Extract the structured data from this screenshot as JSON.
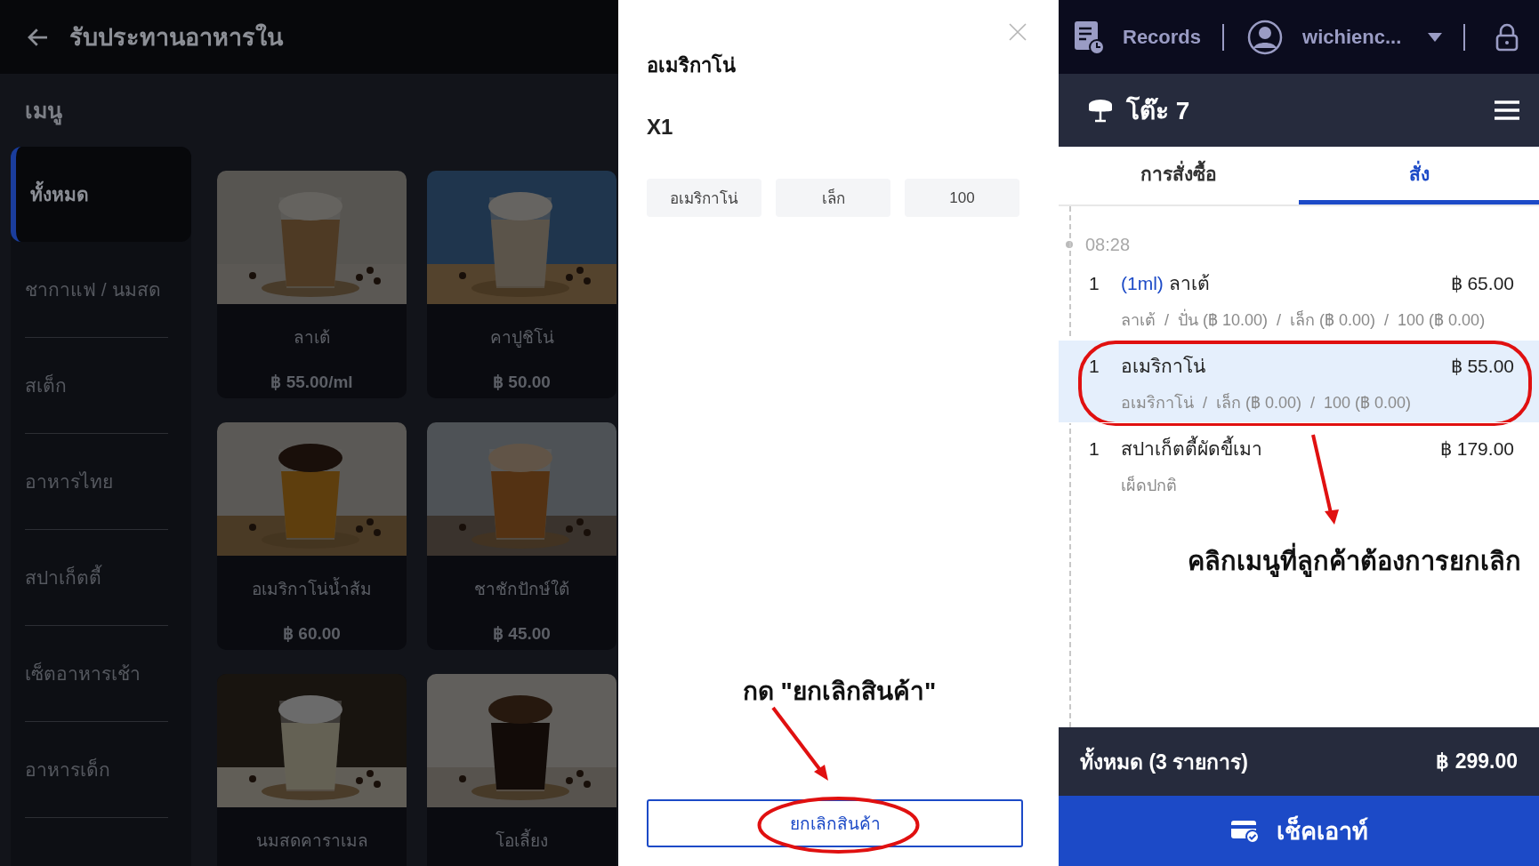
{
  "header": {
    "title": "รับประทานอาหารใน"
  },
  "menu": {
    "heading": "เมนู",
    "categories": [
      {
        "label": "ทั้งหมด",
        "selected": true
      },
      {
        "label": "ชากาแฟ / นมสด",
        "selected": false
      },
      {
        "label": "สเต็ก",
        "selected": false
      },
      {
        "label": "อาหารไทย",
        "selected": false
      },
      {
        "label": "สปาเก็ตตี้",
        "selected": false
      },
      {
        "label": "เซ็ตอาหารเช้า",
        "selected": false
      },
      {
        "label": "อาหารเด็ก",
        "selected": false
      }
    ],
    "products": [
      {
        "name": "ลาเต้",
        "price": "฿ 55.00/ml"
      },
      {
        "name": "คาปูชิโน่",
        "price": "฿ 50.00"
      },
      {
        "name": "อเมริกาโน่น้ำส้ม",
        "price": "฿ 60.00"
      },
      {
        "name": "ชาชักปักษ์ใต้",
        "price": "฿ 45.00"
      },
      {
        "name": "นมสดคาราเมล"
      },
      {
        "name": "โอเลี้ยง"
      }
    ]
  },
  "dialog": {
    "title": "อเมริกาโน่",
    "quantity": "X1",
    "options": [
      "อเมริกาโน่",
      "เล็ก",
      "100"
    ],
    "annotation": "กด \"ยกเลิกสินค้า\"",
    "cancel_button": "ยกเลิกสินค้า"
  },
  "top_bar": {
    "records": "Records",
    "user": "wichienc..."
  },
  "table": {
    "name": "โต๊ะ 7"
  },
  "tabs": [
    {
      "label": "การสั่งซื้อ",
      "selected": false
    },
    {
      "label": "สั่ง",
      "selected": true
    }
  ],
  "order": {
    "time": "08:28",
    "items": [
      {
        "qty": "1",
        "tag": "(1ml)",
        "name": "ลาเต้",
        "price": "฿ 65.00",
        "details": "ลาเต้  /  ปั่น (฿ 10.00)  /  เล็ก (฿ 0.00)  /  100 (฿ 0.00)",
        "selected": false
      },
      {
        "qty": "1",
        "name": "อเมริกาโน่",
        "price": "฿ 55.00",
        "details": "อเมริกาโน่  /  เล็ก (฿ 0.00)  /  100 (฿ 0.00)",
        "selected": true
      },
      {
        "qty": "1",
        "name": "สปาเก็ตตี้ผัดขี้เมา",
        "price": "฿ 179.00",
        "details": "เผ็ดปกติ",
        "selected": false
      }
    ],
    "annotation": "คลิกเมนูที่ลูกค้าต้องการยกเลิก"
  },
  "total": {
    "label": "ทั้งหมด (3 รายการ)",
    "amount": "฿ 299.00"
  },
  "checkout_button": "เช็คเอาท์"
}
